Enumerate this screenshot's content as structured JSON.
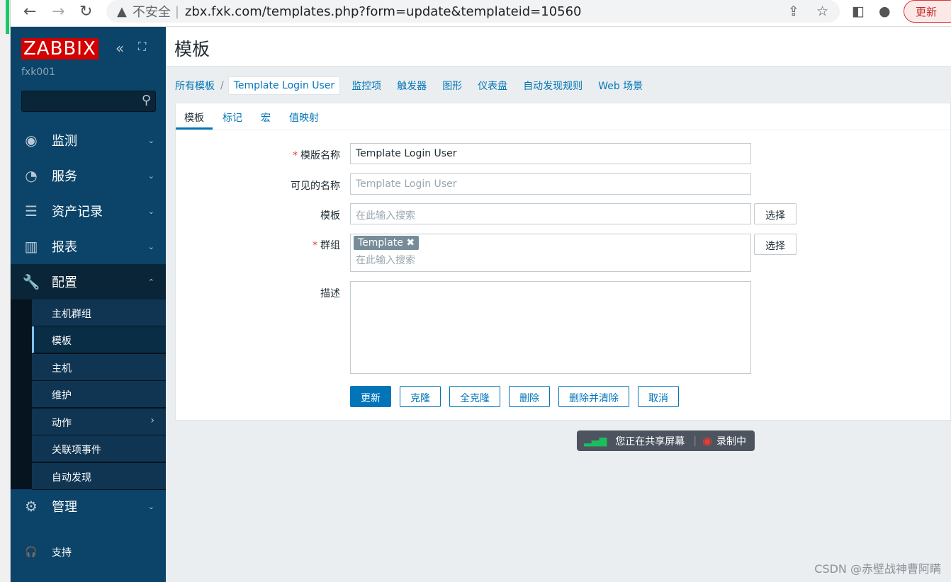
{
  "browser": {
    "security": "不安全",
    "url": "zbx.fxk.com/templates.php?form=update&templateid=10560",
    "update": "更新"
  },
  "sidebar": {
    "logo": "ZABBIX",
    "user": "fxk001",
    "menu": [
      {
        "label": "监测",
        "icon": "eye-icon"
      },
      {
        "label": "服务",
        "icon": "stopwatch-icon"
      },
      {
        "label": "资产记录",
        "icon": "list-icon"
      },
      {
        "label": "报表",
        "icon": "chart-icon"
      },
      {
        "label": "配置",
        "icon": "wrench-icon"
      },
      {
        "label": "管理",
        "icon": "gear-icon"
      }
    ],
    "submenu": [
      "主机群组",
      "模板",
      "主机",
      "维护",
      "动作",
      "关联项事件",
      "自动发现"
    ],
    "support": "支持"
  },
  "header": {
    "title": "模板"
  },
  "breadcrumb": {
    "all": "所有模板",
    "current": "Template Login User",
    "links": [
      "监控项",
      "触发器",
      "图形",
      "仪表盘",
      "自动发现规则",
      "Web 场景"
    ]
  },
  "tabs": [
    "模板",
    "标记",
    "宏",
    "值映射"
  ],
  "form": {
    "name_label": "模版名称",
    "name_value": "Template Login User",
    "visible_label": "可见的名称",
    "visible_placeholder": "Template Login User",
    "template_label": "模板",
    "template_placeholder": "在此输入搜索",
    "select": "选择",
    "group_label": "群组",
    "group_tag": "Template",
    "group_placeholder": "在此输入搜索",
    "desc_label": "描述"
  },
  "buttons": [
    "更新",
    "克隆",
    "全克隆",
    "删除",
    "删除并清除",
    "取消"
  ],
  "share": {
    "text": "您正在共享屏幕",
    "rec": "录制中"
  },
  "watermark": "CSDN @赤壁战神曹阿瞒"
}
